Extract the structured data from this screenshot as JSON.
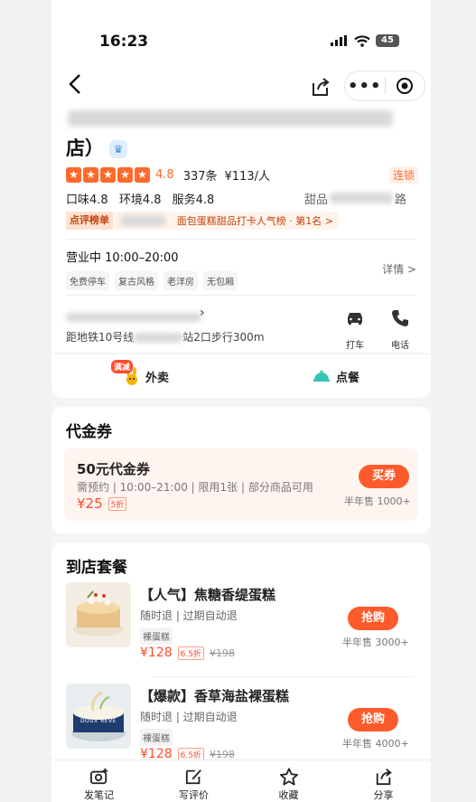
{
  "status_bar": {
    "time": "16:23",
    "battery": "45"
  },
  "shop": {
    "title_suffix": "店）",
    "score": "4.8",
    "review_count": "337条",
    "avg_price": "¥113/人",
    "chain_label": "连锁",
    "sub_scores": [
      "口味4.8",
      "环境4.8",
      "服务4.8"
    ],
    "category": "甜品",
    "area_suffix": "路",
    "rank_tag": "点评榜单",
    "rank_text": "面包蛋糕甜品打卡人气榜 · 第1名 >",
    "hours": "营业中  10:00–20:00",
    "features": [
      "免费停车",
      "复古风格",
      "老洋房",
      "无包厢"
    ],
    "details_link": "详情 >",
    "metro_prefix": "距地铁10号线",
    "metro_suffix": "站2口步行300m",
    "actions": {
      "taxi": "打车",
      "phone": "电话"
    }
  },
  "service_tabs": {
    "takeout": "外卖",
    "takeout_badge": "满减",
    "dine": "点餐"
  },
  "voucher_section": {
    "title": "代金券",
    "item": {
      "name": "50元代金券",
      "desc": "需预约 | 10:00–21:00 | 限用1张 | 部分商品可用",
      "price": "¥25",
      "discount": "5折",
      "button": "买券",
      "sold": "半年售 1000+"
    }
  },
  "package_section": {
    "title": "到店套餐",
    "items": [
      {
        "name": "【人气】焦糖香缇蛋糕",
        "rule": "随时退 | 过期自动退",
        "tag": "裸蛋糕",
        "price": "¥128",
        "discount": "6.5折",
        "old_price": "¥198",
        "button": "抢购",
        "sold": "半年售 3000+"
      },
      {
        "name": "【爆款】香草海盐裸蛋糕",
        "rule": "随时退 | 过期自动退",
        "tag": "裸蛋糕",
        "price": "¥128",
        "discount": "6.5折",
        "old_price": "¥198",
        "button": "抢购",
        "sold": "半年售 4000+",
        "cake_text": "DOUX RÊVE"
      }
    ]
  },
  "tab_bar": {
    "note": "发笔记",
    "review": "写评价",
    "fav": "收藏",
    "share": "分享"
  },
  "colors": {
    "accent": "#ff5a2b",
    "star": "#ff6a2b"
  }
}
